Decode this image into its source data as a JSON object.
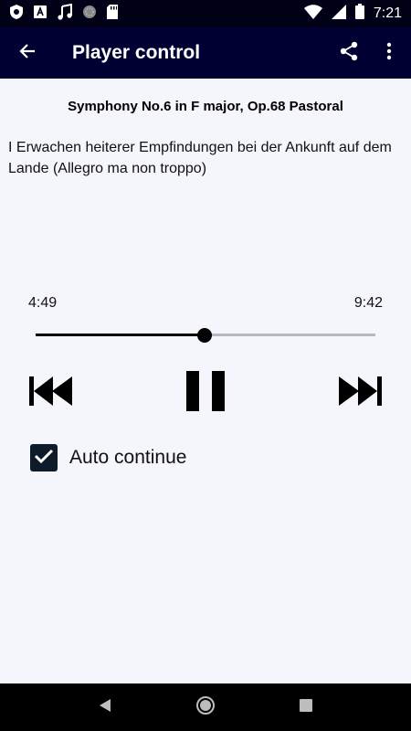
{
  "status_bar": {
    "time": "7:21",
    "left_icons": [
      "shield-icon",
      "text-a-icon",
      "music-note-icon",
      "circle-dots-icon",
      "sd-card-icon"
    ],
    "right_icons": [
      "wifi-icon",
      "signal-icon",
      "battery-icon"
    ]
  },
  "app_bar": {
    "title": "Player control",
    "back_icon": "back-arrow-icon",
    "share_icon": "share-icon",
    "more_icon": "more-vert-icon",
    "background": "#000033"
  },
  "player": {
    "album": "Symphony No.6 in F major, Op.68 Pastoral",
    "track": "I Erwachen heiterer Empfindungen bei der Ankunft auf dem Lande (Allegro ma non troppo)",
    "current_time": "4:49",
    "total_time": "9:42",
    "progress": 0.497,
    "controls": [
      "skip-previous-icon",
      "pause-icon",
      "skip-next-icon"
    ]
  },
  "options": {
    "auto_continue_label": "Auto continue",
    "auto_continue_checked": true
  },
  "nav_bar": {
    "buttons": [
      "back-triangle-icon",
      "home-circle-icon",
      "recents-square-icon"
    ]
  }
}
